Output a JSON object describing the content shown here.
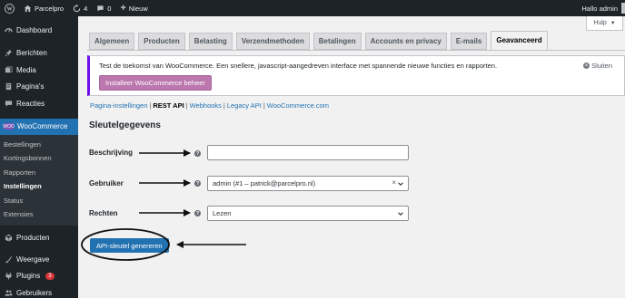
{
  "adminbar": {
    "site_name": "Parcelpro",
    "updates_count": "4",
    "comments_count": "0",
    "new_label": "Nieuw",
    "greeting": "Hallo admin"
  },
  "sidebar": {
    "items": [
      {
        "label": "Dashboard",
        "icon": "gauge-icon"
      },
      {
        "label": "Berichten",
        "icon": "pin-icon"
      },
      {
        "label": "Media",
        "icon": "media-icon"
      },
      {
        "label": "Pagina's",
        "icon": "page-icon"
      },
      {
        "label": "Reacties",
        "icon": "comment-icon"
      },
      {
        "label": "WooCommerce",
        "icon": "woo-icon"
      }
    ],
    "woo_logo_text": "WOO",
    "submenu": [
      "Bestellingen",
      "Kortingsbonnen",
      "Rapporten",
      "Instellingen",
      "Status",
      "Extensies"
    ],
    "bottom_items": [
      {
        "label": "Producten",
        "icon": "box-icon"
      },
      {
        "label": "Weergave",
        "icon": "brush-icon"
      },
      {
        "label": "Plugins",
        "icon": "plug-icon",
        "badge": "3"
      },
      {
        "label": "Gebruikers",
        "icon": "users-icon"
      }
    ]
  },
  "help": {
    "label": "Hulp"
  },
  "tabs": [
    "Algemeen",
    "Producten",
    "Belasting",
    "Verzendmethoden",
    "Betalingen",
    "Accounts en privacy",
    "E-mails",
    "Geavanceerd"
  ],
  "notice": {
    "text": "Test de toekomst van WooCommerce. Een snellere, javascript-aangedreven interface met spannende nieuwe functies en rapporten.",
    "button": "Installeer WooCommerce beheer",
    "dismiss": "Sluiten"
  },
  "subnav": {
    "links": [
      "Pagina-instellingen",
      "REST API",
      "Webhooks",
      "Legacy API",
      "WooCommerce.com"
    ],
    "separator": "|"
  },
  "section_title": "Sleutelgegevens",
  "form": {
    "description_label": "Beschrijving",
    "description_value": "",
    "user_label": "Gebruiker",
    "user_value": "admin (#1 – patrick@parcelpro.nl)",
    "user_clear": "×",
    "permissions_label": "Rechten",
    "permissions_value": "Lezen",
    "help_tip": "?"
  },
  "generate_button": "API-sleutel genereren",
  "colors": {
    "admin_dark": "#1d2327",
    "accent_blue": "#2271b1",
    "woo_purple": "#bb77ae",
    "badge_red": "#d63638"
  }
}
